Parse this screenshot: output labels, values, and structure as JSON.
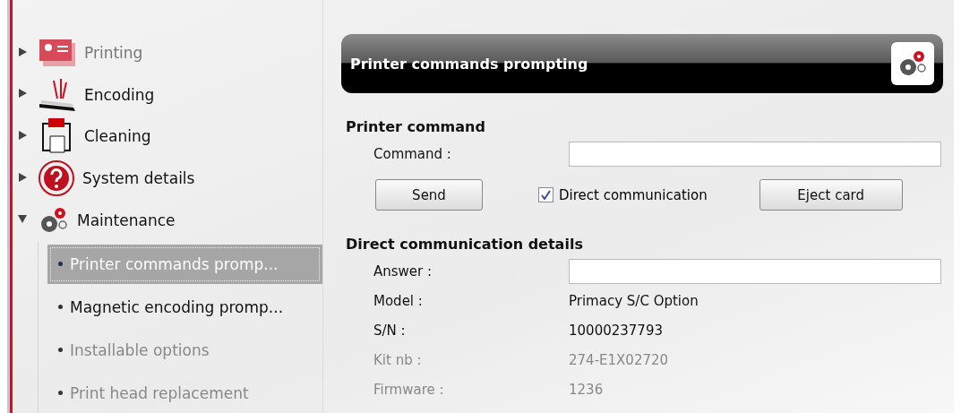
{
  "sidebar": {
    "items": [
      {
        "label": "Printing",
        "kind": "printing",
        "expanded": false,
        "faded": true
      },
      {
        "label": "Encoding",
        "kind": "encoding",
        "expanded": false,
        "faded": false
      },
      {
        "label": "Cleaning",
        "kind": "cleaning",
        "expanded": false,
        "faded": false
      },
      {
        "label": "System details",
        "kind": "help",
        "expanded": false,
        "faded": false
      },
      {
        "label": "Maintenance",
        "kind": "gears",
        "expanded": true,
        "faded": false,
        "children": [
          {
            "label": "Printer commands promp...",
            "selected": true,
            "faded": false
          },
          {
            "label": "Magnetic encoding promp...",
            "selected": false,
            "faded": false
          },
          {
            "label": "Installable options",
            "selected": false,
            "faded": true
          },
          {
            "label": "Print head replacement",
            "selected": false,
            "faded": true
          }
        ]
      }
    ]
  },
  "panel": {
    "title": "Printer commands prompting",
    "sections": [
      {
        "heading": "Printer command",
        "command_label": "Command :",
        "send": "Send",
        "direct": {
          "label": "Direct communication",
          "checked": true
        },
        "eject": "Eject card"
      },
      {
        "heading": "Direct communication details",
        "answer_label": "Answer :",
        "rows": [
          {
            "label": "Model :",
            "value": "Primacy S/C Option",
            "faded": false
          },
          {
            "label": "S/N :",
            "value": "10000237793",
            "faded": false
          },
          {
            "label": "Kit nb :",
            "value": "274-E1X02720",
            "faded": true
          },
          {
            "label": "Firmware :",
            "value": "1236",
            "faded": true
          }
        ]
      }
    ]
  }
}
